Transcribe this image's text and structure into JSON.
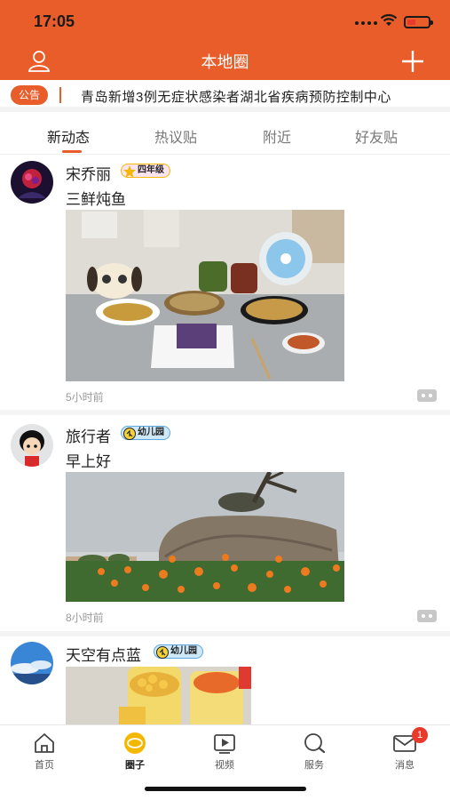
{
  "status_bar": {
    "time": "17:05"
  },
  "header": {
    "title": "本地圈"
  },
  "notice": {
    "tag": "公告",
    "text": "青岛新增3例无症状感染者湖北省疾病预防控制中心"
  },
  "tabs": [
    {
      "label": "新动态",
      "active": true
    },
    {
      "label": "热议贴",
      "active": false
    },
    {
      "label": "附近",
      "active": false
    },
    {
      "label": "好友贴",
      "active": false
    }
  ],
  "posts": [
    {
      "username": "宋乔丽",
      "level": "四年级",
      "text": "三鲜炖鱼",
      "time": "5小时前",
      "image": "food-table-photo"
    },
    {
      "username": "旅行者",
      "level": "幼儿园",
      "text": "早上好",
      "time": "8小时前",
      "image": "flowers-rock-photo"
    },
    {
      "username": "天空有点蓝",
      "level": "幼儿园",
      "text": "",
      "time": "",
      "image": "snack-cups-photo"
    }
  ],
  "bottom_nav": [
    {
      "label": "首页",
      "icon": "home-icon",
      "active": false
    },
    {
      "label": "圈子",
      "icon": "circle-icon",
      "active": true
    },
    {
      "label": "视频",
      "icon": "video-icon",
      "active": false
    },
    {
      "label": "服务",
      "icon": "search-icon",
      "active": false
    },
    {
      "label": "消息",
      "icon": "mail-icon",
      "active": false,
      "badge": "1"
    }
  ],
  "colors": {
    "accent": "#e85d2a",
    "badge_red": "#e8392a",
    "level_gold": "#f5b800",
    "level_blue": "#5ba8e0"
  }
}
